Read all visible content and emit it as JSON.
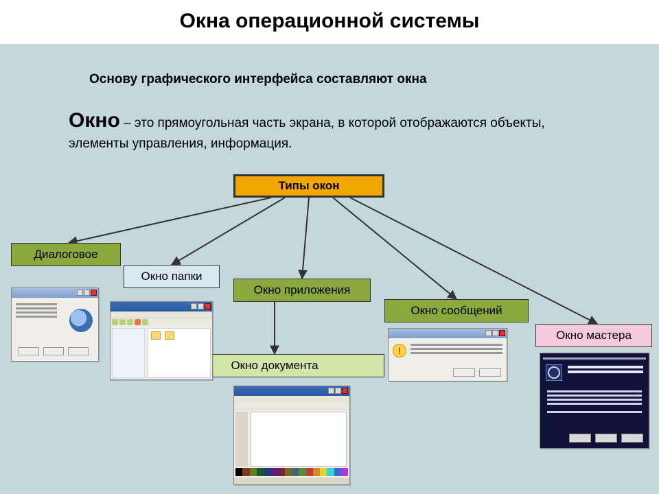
{
  "title": "Окна операционной системы",
  "intro": "Основу графического интерфейса составляют окна",
  "definition": {
    "term": "Окно",
    "text": " – это прямоугольная часть экрана, в которой отображаются объекты, элементы управления, информация."
  },
  "root_label": "Типы окон",
  "nodes": {
    "dialog": "Диалоговое",
    "folder": "Окно папки",
    "app": "Окно приложения",
    "messages": "Окно сообщений",
    "wizard": "Окно мастера",
    "document": "Окно документа"
  },
  "palette_colors": [
    "#000000",
    "#7a3b1f",
    "#6a7a1f",
    "#1f5a2a",
    "#1f3b7a",
    "#5a1f7a",
    "#7a1f4a",
    "#7a6a1f",
    "#3b6a7a",
    "#5a8a3a",
    "#c23a3a",
    "#d68a2a",
    "#e0d43a",
    "#3ad4d4",
    "#3a6ad4",
    "#b03ad4"
  ]
}
